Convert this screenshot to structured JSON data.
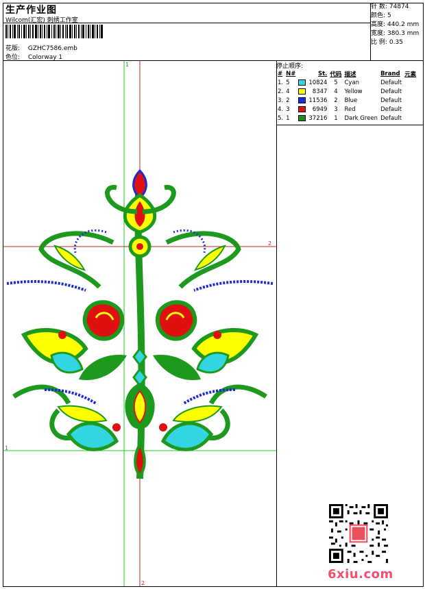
{
  "header": {
    "title": "生产作业图",
    "subtitle": "Wilcom(汇宏) 刺绣工作室",
    "design_label": "花版:",
    "design_value": "GZHC7586.emb",
    "colorway_label": "色位:",
    "colorway_value": "Colorway 1"
  },
  "stats": [
    {
      "label": "针 数:",
      "value": "74874"
    },
    {
      "label": "颜色:",
      "value": "5"
    },
    {
      "label": "高度:",
      "value": "440.2 mm"
    },
    {
      "label": "宽度:",
      "value": "380.3 mm"
    },
    {
      "label": "比 例:",
      "value": "0.35"
    }
  ],
  "stop_sequence": {
    "title": "停止顺序:",
    "columns": [
      "#",
      "N#",
      "St.",
      "代码",
      "描述",
      "Brand",
      "元素"
    ],
    "rows": [
      {
        "index": "1.",
        "n": "5",
        "color": "#33d6e0",
        "stitches": "10824",
        "code": "5",
        "desc": "Cyan",
        "brand": "Default"
      },
      {
        "index": "2.",
        "n": "4",
        "color": "#ffff00",
        "stitches": "8347",
        "code": "4",
        "desc": "Yellow",
        "brand": "Default"
      },
      {
        "index": "3.",
        "n": "2",
        "color": "#1a2ad6",
        "stitches": "11536",
        "code": "2",
        "desc": "Blue",
        "brand": "Default"
      },
      {
        "index": "4.",
        "n": "3",
        "color": "#e01010",
        "stitches": "6949",
        "code": "3",
        "desc": "Red",
        "brand": "Default"
      },
      {
        "index": "5.",
        "n": "1",
        "color": "#1d8f1d",
        "stitches": "37216",
        "code": "1",
        "desc": "Dark Green",
        "brand": "Default"
      }
    ]
  },
  "guides": {
    "green_label": "1",
    "red_label": "2"
  },
  "watermark": "6xiu.com",
  "colors": {
    "green": "#1d9a1d",
    "guide_green": "#22cc22",
    "guide_red": "#cc2222",
    "cyan": "#33d6e0",
    "yellow": "#ffff00",
    "blue": "#1a2ad6",
    "red": "#e01010"
  }
}
